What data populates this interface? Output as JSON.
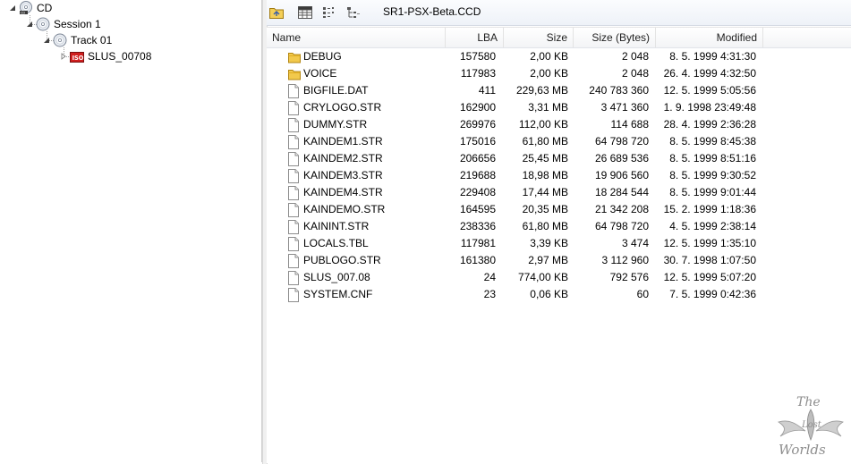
{
  "tree": {
    "nodes": [
      {
        "label": "CD"
      },
      {
        "label": "Session 1"
      },
      {
        "label": "Track 01"
      },
      {
        "label": "SLUS_00708",
        "badge": "ISO"
      }
    ]
  },
  "toolbar": {
    "path": "SR1-PSX-Beta.CCD"
  },
  "columns": {
    "name": "Name",
    "lba": "LBA",
    "size": "Size",
    "size_bytes": "Size (Bytes)",
    "modified": "Modified"
  },
  "files": [
    {
      "name": "DEBUG",
      "type": "folder",
      "lba": "157580",
      "size": "2,00 KB",
      "bytes": "2 048",
      "modified": "8. 5. 1999 4:31:30"
    },
    {
      "name": "VOICE",
      "type": "folder",
      "lba": "117983",
      "size": "2,00 KB",
      "bytes": "2 048",
      "modified": "26. 4. 1999 4:32:50"
    },
    {
      "name": "BIGFILE.DAT",
      "type": "file",
      "lba": "411",
      "size": "229,63 MB",
      "bytes": "240 783 360",
      "modified": "12. 5. 1999 5:05:56"
    },
    {
      "name": "CRYLOGO.STR",
      "type": "file",
      "lba": "162900",
      "size": "3,31 MB",
      "bytes": "3 471 360",
      "modified": "1. 9. 1998 23:49:48"
    },
    {
      "name": "DUMMY.STR",
      "type": "file",
      "lba": "269976",
      "size": "112,00 KB",
      "bytes": "114 688",
      "modified": "28. 4. 1999 2:36:28"
    },
    {
      "name": "KAINDEM1.STR",
      "type": "file",
      "lba": "175016",
      "size": "61,80 MB",
      "bytes": "64 798 720",
      "modified": "8. 5. 1999 8:45:38"
    },
    {
      "name": "KAINDEM2.STR",
      "type": "file",
      "lba": "206656",
      "size": "25,45 MB",
      "bytes": "26 689 536",
      "modified": "8. 5. 1999 8:51:16"
    },
    {
      "name": "KAINDEM3.STR",
      "type": "file",
      "lba": "219688",
      "size": "18,98 MB",
      "bytes": "19 906 560",
      "modified": "8. 5. 1999 9:30:52"
    },
    {
      "name": "KAINDEM4.STR",
      "type": "file",
      "lba": "229408",
      "size": "17,44 MB",
      "bytes": "18 284 544",
      "modified": "8. 5. 1999 9:01:44"
    },
    {
      "name": "KAINDEMO.STR",
      "type": "file",
      "lba": "164595",
      "size": "20,35 MB",
      "bytes": "21 342 208",
      "modified": "15. 2. 1999 1:18:36"
    },
    {
      "name": "KAININT.STR",
      "type": "file",
      "lba": "238336",
      "size": "61,80 MB",
      "bytes": "64 798 720",
      "modified": "4. 5. 1999 2:38:14"
    },
    {
      "name": "LOCALS.TBL",
      "type": "file",
      "lba": "117981",
      "size": "3,39 KB",
      "bytes": "3 474",
      "modified": "12. 5. 1999 1:35:10"
    },
    {
      "name": "PUBLOGO.STR",
      "type": "file",
      "lba": "161380",
      "size": "2,97 MB",
      "bytes": "3 112 960",
      "modified": "30. 7. 1998 1:07:50"
    },
    {
      "name": "SLUS_007.08",
      "type": "file",
      "lba": "24",
      "size": "774,00 KB",
      "bytes": "792 576",
      "modified": "12. 5. 1999 5:07:20"
    },
    {
      "name": "SYSTEM.CNF",
      "type": "file",
      "lba": "23",
      "size": "0,06 KB",
      "bytes": "60",
      "modified": "7. 5. 1999 0:42:36"
    }
  ],
  "watermark": {
    "text_top": "The",
    "text_mid": "Lost",
    "text_bottom": "Worlds"
  }
}
